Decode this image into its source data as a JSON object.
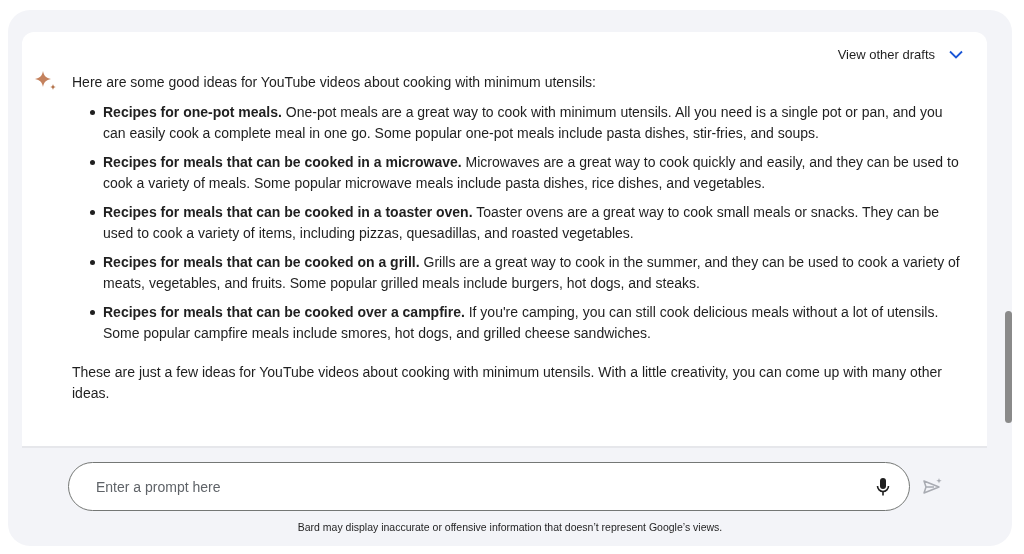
{
  "drafts_button": {
    "label": "View other drafts"
  },
  "response": {
    "intro": "Here are some good ideas for YouTube videos about cooking with minimum utensils:",
    "items": [
      {
        "text": "**Recipes for one-pot meals.** One-pot meals are a great way to cook with minimum utensils. All you need is a single pot or pan, and you can easily cook a complete meal in one go. Some popular one-pot meals include pasta dishes, stir-fries, and soups."
      },
      {
        "text": "**Recipes for meals that can be cooked in a microwave.** Microwaves are a great way to cook quickly and easily, and they can be used to cook a variety of meals. Some popular microwave meals include pasta dishes, rice dishes, and vegetables."
      },
      {
        "text": "**Recipes for meals that can be cooked in a toaster oven.** Toaster ovens are a great way to cook small meals or snacks. They can be used to cook a variety of items, including pizzas, quesadillas, and roasted vegetables."
      },
      {
        "text": "**Recipes for meals that can be cooked on a grill.** Grills are a great way to cook in the summer, and they can be used to cook a variety of meats, vegetables, and fruits. Some popular grilled meals include burgers, hot dogs, and steaks."
      },
      {
        "text": "**Recipes for meals that can be cooked over a campfire.** If you're camping, you can still cook delicious meals without a lot of utensils. Some popular campfire meals include smores, hot dogs, and grilled cheese sandwiches."
      }
    ],
    "closing": "These are just a few ideas for YouTube videos about cooking with minimum utensils. With a little creativity, you can come up with many other ideas."
  },
  "prompt": {
    "placeholder": "Enter a prompt here"
  },
  "disclaimer": "Bard may display inaccurate or offensive information that doesn’t represent Google’s views."
}
